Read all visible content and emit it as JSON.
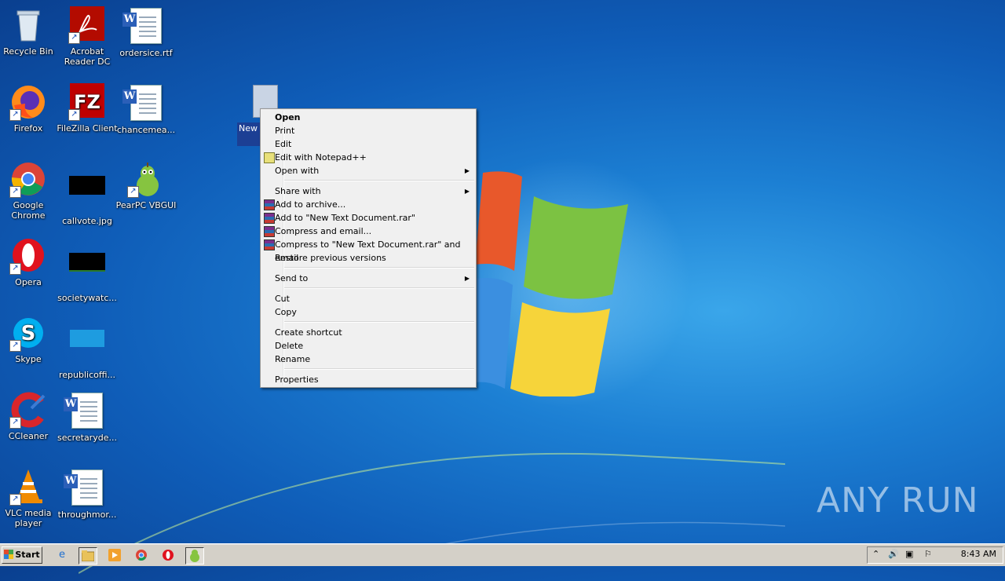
{
  "desktop_icons": [
    {
      "label": "Recycle Bin"
    },
    {
      "label": "Acrobat Reader DC"
    },
    {
      "label": "ordersice.rtf"
    },
    {
      "label": "Firefox"
    },
    {
      "label": "FileZilla Client"
    },
    {
      "label": "chancemea..."
    },
    {
      "label": "Google Chrome"
    },
    {
      "label": "callvote.jpg"
    },
    {
      "label": "PearPC VBGUI"
    },
    {
      "label": "Opera"
    },
    {
      "label": "societywatc..."
    },
    {
      "label": "Skype"
    },
    {
      "label": "republicoffi..."
    },
    {
      "label": "CCleaner"
    },
    {
      "label": "secretaryde..."
    },
    {
      "label": "VLC media player"
    },
    {
      "label": "throughmor..."
    }
  ],
  "selected_file": {
    "label": "New Docum"
  },
  "context_menu": {
    "items": [
      {
        "label": "Open"
      },
      {
        "label": "Print"
      },
      {
        "label": "Edit"
      },
      {
        "label": "Edit with Notepad++",
        "icon": "notepadpp-icon"
      },
      {
        "label": "Open with",
        "submenu": true
      },
      {
        "label": "Share with",
        "submenu": true
      },
      {
        "label": "Add to archive...",
        "icon": "winrar-icon"
      },
      {
        "label": "Add to \"New Text Document.rar\"",
        "icon": "winrar-icon"
      },
      {
        "label": "Compress and email...",
        "icon": "winrar-icon"
      },
      {
        "label": "Compress to \"New Text Document.rar\" and email",
        "icon": "winrar-icon"
      },
      {
        "label": "Restore previous versions"
      },
      {
        "label": "Send to",
        "submenu": true
      },
      {
        "label": "Cut"
      },
      {
        "label": "Copy"
      },
      {
        "label": "Create shortcut"
      },
      {
        "label": "Delete"
      },
      {
        "label": "Rename"
      },
      {
        "label": "Properties"
      }
    ]
  },
  "taskbar": {
    "start_label": "Start",
    "quick_launch": [
      "internet-explorer-icon",
      "explorer-icon",
      "media-player-icon",
      "chrome-icon",
      "opera-icon",
      "pearpc-icon"
    ],
    "clock": "8:43 AM"
  },
  "watermark": "ANY RUN"
}
